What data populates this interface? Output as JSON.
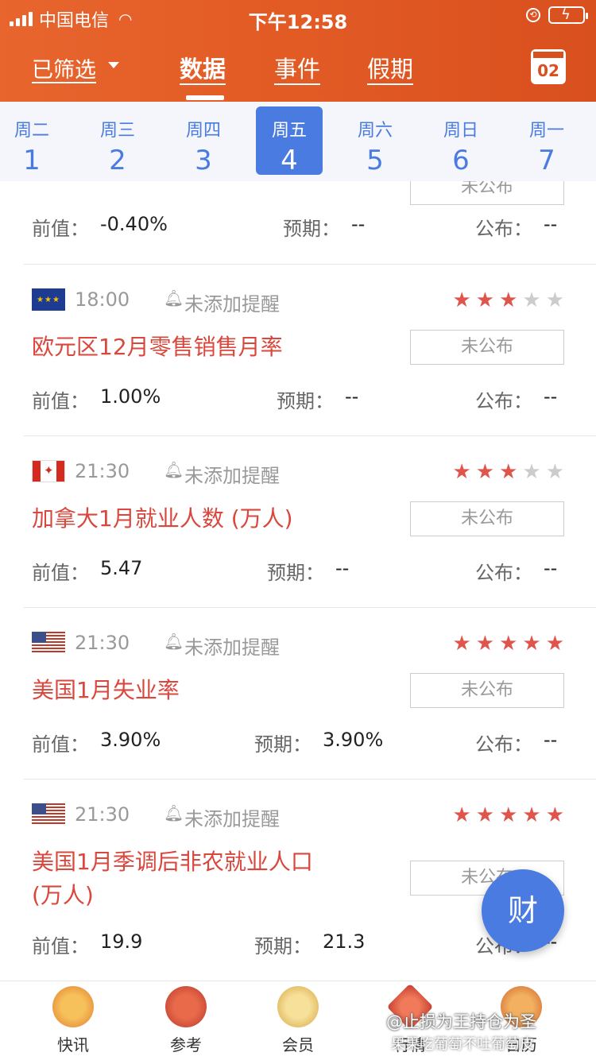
{
  "status": {
    "carrier": "中国电信",
    "time": "下午12:58"
  },
  "header": {
    "filter_label": "已筛选",
    "tabs": [
      "数据",
      "事件",
      "假期"
    ],
    "calendar_day": "02"
  },
  "week": [
    {
      "name": "周二",
      "num": "1"
    },
    {
      "name": "周三",
      "num": "2"
    },
    {
      "name": "周四",
      "num": "3"
    },
    {
      "name": "周五",
      "num": "4",
      "active": true
    },
    {
      "name": "周六",
      "num": "5"
    },
    {
      "name": "周日",
      "num": "6"
    },
    {
      "name": "周一",
      "num": "7"
    }
  ],
  "labels": {
    "prev": "前值：",
    "expect": "预期：",
    "actual": "公布：",
    "reminder": "未添加提醒",
    "unpublished": "未公布"
  },
  "events": [
    {
      "partial": true,
      "prev": "-0.40%",
      "expect": "--",
      "actual": "--"
    },
    {
      "flag": "EU",
      "time": "18:00",
      "stars": 3,
      "title": "欧元区12月零售销售月率",
      "prev": "1.00%",
      "expect": "--",
      "actual": "--"
    },
    {
      "flag": "CA",
      "time": "21:30",
      "stars": 3,
      "title": "加拿大1月就业人数 (万人)",
      "prev": "5.47",
      "expect": "--",
      "actual": "--"
    },
    {
      "flag": "US",
      "time": "21:30",
      "stars": 5,
      "title": "美国1月失业率",
      "prev": "3.90%",
      "expect": "3.90%",
      "actual": "--"
    },
    {
      "flag": "US",
      "time": "21:30",
      "stars": 5,
      "title": "美国1月季调后非农就业人口",
      "title2": "(万人)",
      "prev": "19.9",
      "expect": "21.3",
      "actual": "--"
    }
  ],
  "fab": {
    "label": "财"
  },
  "tabbar": [
    {
      "label": "快讯",
      "color": "#f0a040"
    },
    {
      "label": "参考",
      "color": "#d9473d"
    },
    {
      "label": "会员",
      "color": "#e8c060"
    },
    {
      "label": "行情",
      "color": "#d9473d"
    },
    {
      "label": "日历",
      "color": "#e08a3a"
    }
  ],
  "watermark": {
    "line1": "@止损为王持仓为圣",
    "line2": "果果吃葡萄不吐葡萄皮"
  }
}
